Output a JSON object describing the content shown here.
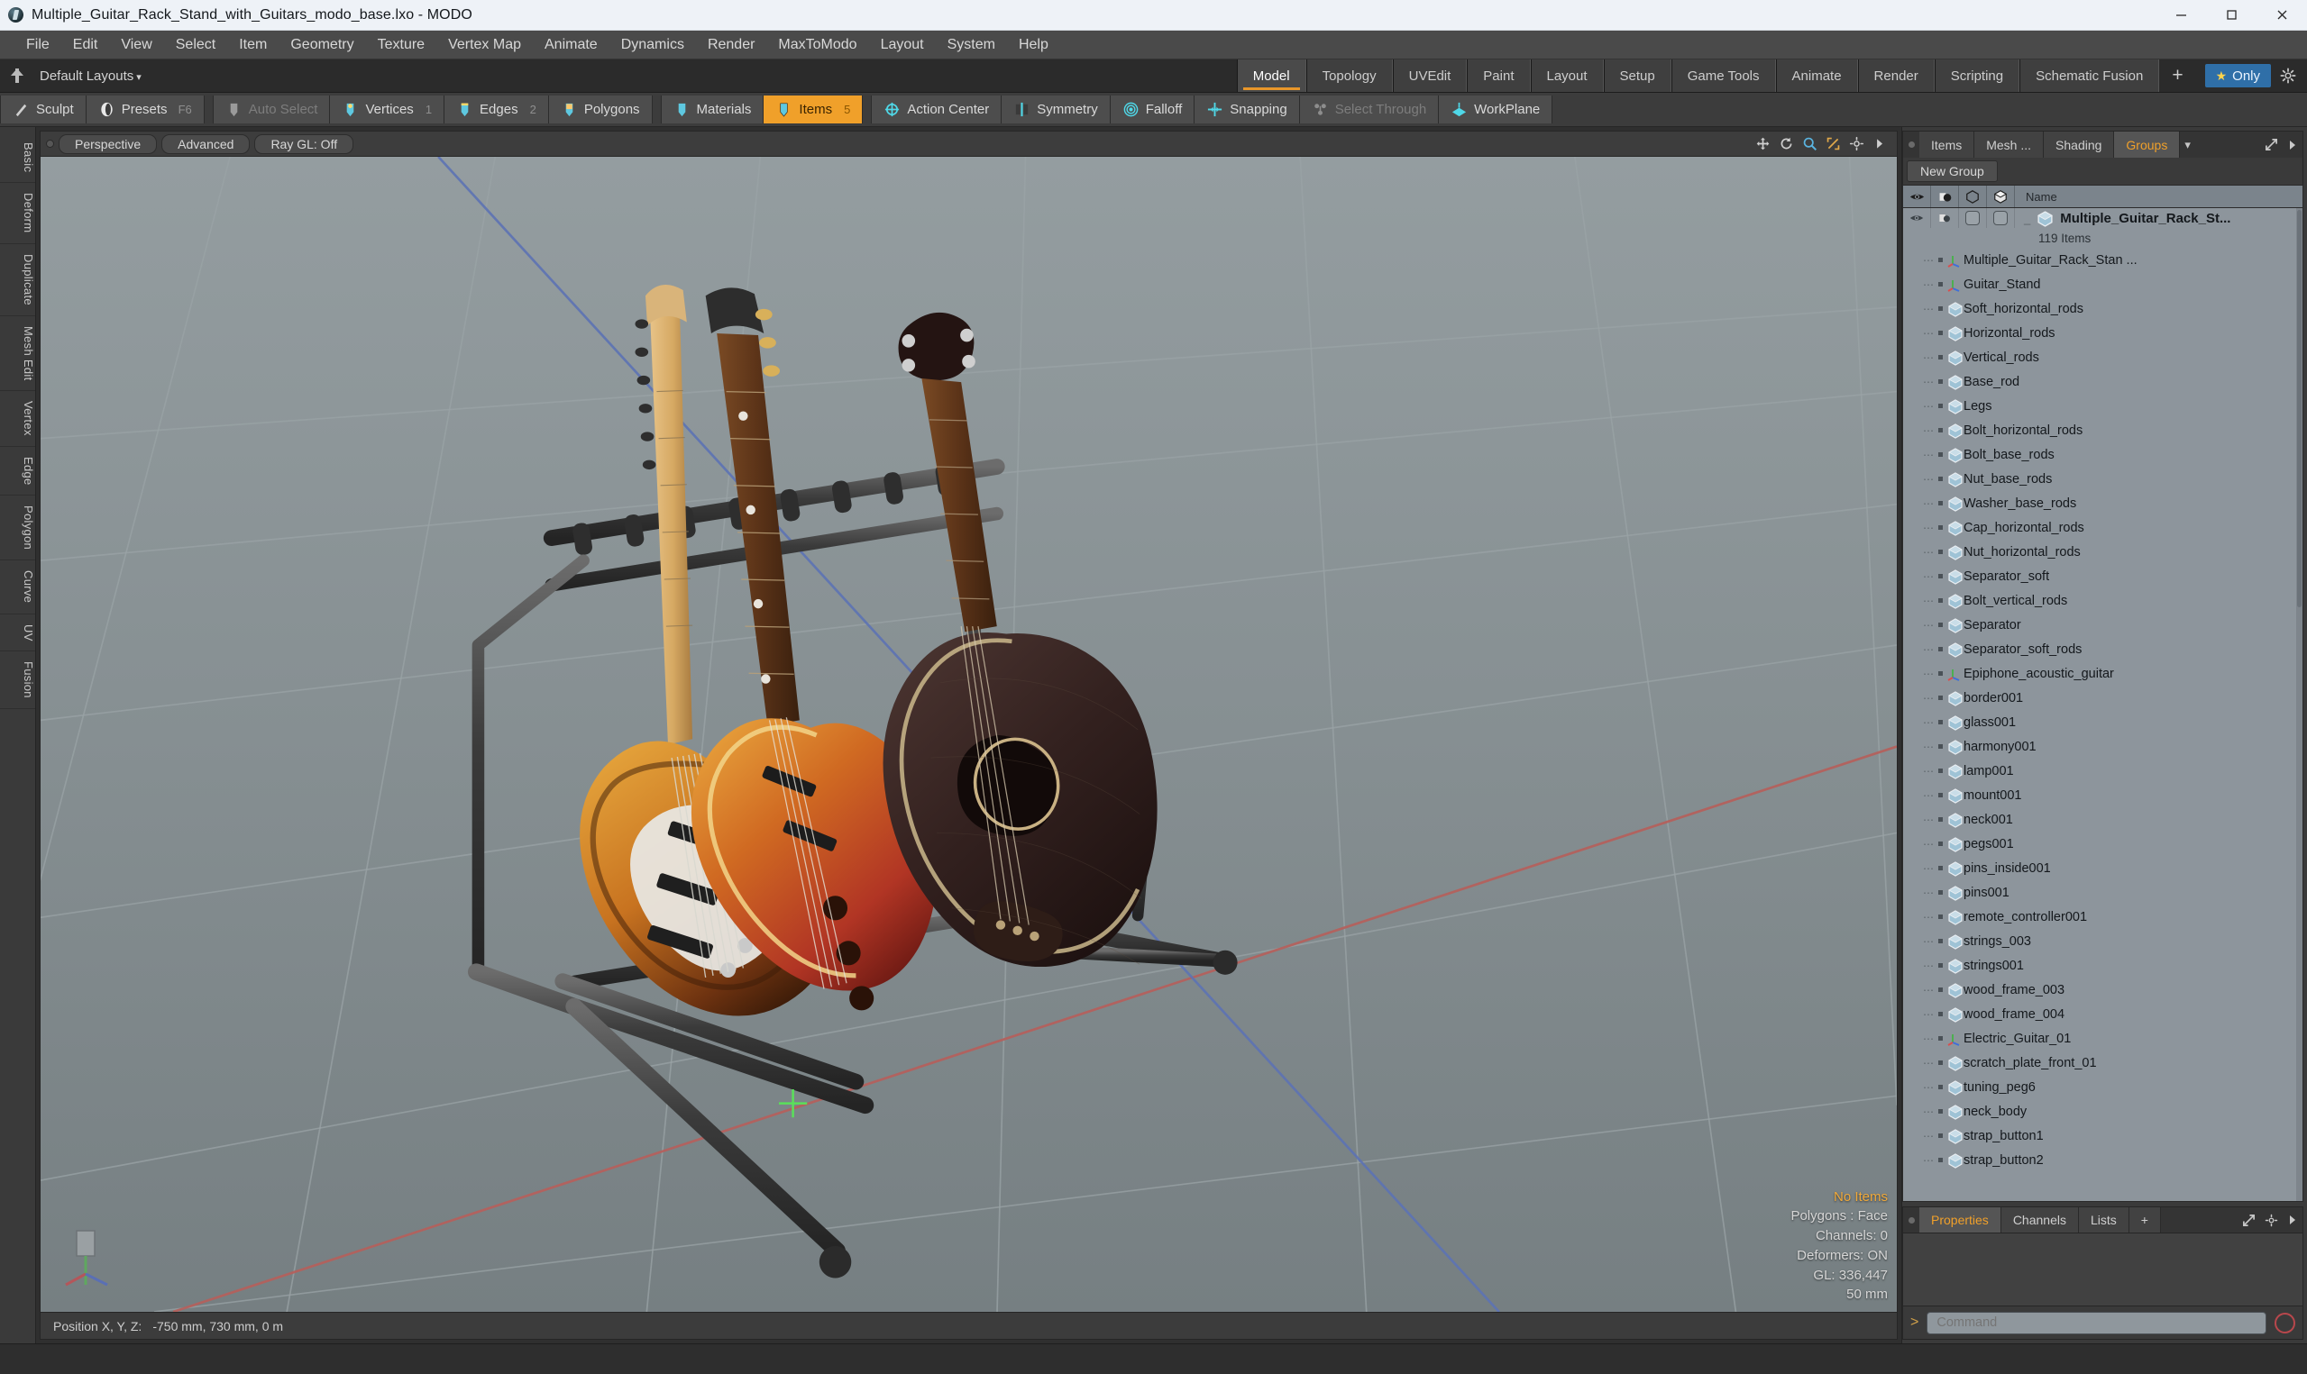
{
  "window": {
    "title": "Multiple_Guitar_Rack_Stand_with_Guitars_modo_base.lxo - MODO",
    "app_icon": "modo-app-icon",
    "minimize": "minimize-icon",
    "maximize": "maximize-icon",
    "close": "close-icon"
  },
  "menubar": {
    "items": [
      {
        "label": "File"
      },
      {
        "label": "Edit"
      },
      {
        "label": "View"
      },
      {
        "label": "Select"
      },
      {
        "label": "Item"
      },
      {
        "label": "Geometry"
      },
      {
        "label": "Texture"
      },
      {
        "label": "Vertex Map"
      },
      {
        "label": "Animate"
      },
      {
        "label": "Dynamics"
      },
      {
        "label": "Render"
      },
      {
        "label": "MaxToModo"
      },
      {
        "label": "Layout"
      },
      {
        "label": "System"
      },
      {
        "label": "Help"
      }
    ]
  },
  "layoutbar": {
    "pin_icon": "pin-icon",
    "layouts_label": "Default Layouts",
    "caret": "▾",
    "tabs": [
      {
        "label": "Model",
        "active": true
      },
      {
        "label": "Topology",
        "active": false
      },
      {
        "label": "UVEdit",
        "active": false
      },
      {
        "label": "Paint",
        "active": false
      },
      {
        "label": "Layout",
        "active": false
      },
      {
        "label": "Setup",
        "active": false
      },
      {
        "label": "Game Tools",
        "active": false
      },
      {
        "label": "Animate",
        "active": false
      },
      {
        "label": "Render",
        "active": false
      },
      {
        "label": "Scripting",
        "active": false
      },
      {
        "label": "Schematic Fusion",
        "active": false
      }
    ],
    "add_label": "+",
    "only_label": "Only",
    "only_star": "★",
    "only_color": "#2f6fa8",
    "gear_icon": "gear-icon"
  },
  "modebar": {
    "groups": [
      {
        "buttons": [
          {
            "label": "Sculpt",
            "icon": "sculpt-icon",
            "key": "",
            "num": "",
            "state": "normal"
          },
          {
            "label": "Presets",
            "icon": "presets-icon",
            "key": "F6",
            "num": "",
            "state": "normal"
          }
        ]
      },
      {
        "buttons": [
          {
            "label": "Auto Select",
            "icon": "auto-select-icon",
            "key": "",
            "num": "",
            "state": "dim"
          },
          {
            "label": "Vertices",
            "icon": "vertices-icon",
            "key": "",
            "num": "1",
            "state": "normal"
          },
          {
            "label": "Edges",
            "icon": "edges-icon",
            "key": "",
            "num": "2",
            "state": "normal"
          },
          {
            "label": "Polygons",
            "icon": "polygons-icon",
            "key": "",
            "num": "",
            "state": "normal"
          }
        ]
      },
      {
        "buttons": [
          {
            "label": "Materials",
            "icon": "materials-icon",
            "key": "",
            "num": "",
            "state": "normal"
          },
          {
            "label": "Items",
            "icon": "items-icon",
            "key": "",
            "num": "5",
            "state": "selected"
          }
        ]
      },
      {
        "buttons": [
          {
            "label": "Action Center",
            "icon": "action-center-icon",
            "key": "",
            "num": "",
            "state": "normal"
          },
          {
            "label": "Symmetry",
            "icon": "symmetry-icon",
            "key": "",
            "num": "",
            "state": "normal"
          },
          {
            "label": "Falloff",
            "icon": "falloff-icon",
            "key": "",
            "num": "",
            "state": "normal"
          },
          {
            "label": "Snapping",
            "icon": "snapping-icon",
            "key": "",
            "num": "",
            "state": "normal"
          },
          {
            "label": "Select Through",
            "icon": "select-through-icon",
            "key": "",
            "num": "",
            "state": "dim"
          },
          {
            "label": "WorkPlane",
            "icon": "workplane-icon",
            "key": "",
            "num": "",
            "state": "normal"
          }
        ]
      }
    ]
  },
  "left_rail": {
    "items": [
      {
        "label": "Basic"
      },
      {
        "label": "Deform"
      },
      {
        "label": "Duplicate"
      },
      {
        "label": "Mesh Edit"
      },
      {
        "label": "Vertex"
      },
      {
        "label": "Edge"
      },
      {
        "label": "Polygon"
      },
      {
        "label": "Curve"
      },
      {
        "label": "UV"
      },
      {
        "label": "Fusion"
      }
    ]
  },
  "viewport": {
    "header": {
      "dot": "viewport-menu-dot",
      "chips": [
        {
          "label": "Perspective"
        },
        {
          "label": "Advanced"
        },
        {
          "label": "Ray GL: Off"
        }
      ],
      "tools": [
        {
          "icon": "move-view-icon"
        },
        {
          "icon": "rotate-view-icon"
        },
        {
          "icon": "zoom-view-icon"
        },
        {
          "icon": "fit-view-icon"
        },
        {
          "icon": "viewport-gear-icon"
        },
        {
          "icon": "viewport-expand-icon"
        }
      ]
    },
    "stats": [
      {
        "label": "No Items",
        "highlight": true
      },
      {
        "label": "Polygons : Face",
        "highlight": false
      },
      {
        "label": "Channels: 0",
        "highlight": false
      },
      {
        "label": "Deformers: ON",
        "highlight": false
      },
      {
        "label": "GL: 336,447",
        "highlight": false
      },
      {
        "label": "50 mm",
        "highlight": false
      }
    ],
    "axis_gizmo": "axis-gizmo-icon"
  },
  "statusbar": {
    "position_label": "Position X, Y, Z:",
    "position_value": "-750 mm, 730 mm, 0 m"
  },
  "right_panel": {
    "tabs": [
      {
        "label": "Items",
        "active": false
      },
      {
        "label": "Mesh ...",
        "active": false
      },
      {
        "label": "Shading",
        "active": false
      },
      {
        "label": "Groups",
        "active": true
      }
    ],
    "tab_caret": "▾",
    "expand_icon": "panel-expand-icon",
    "more_icon": "panel-more-icon",
    "new_group_label": "New Group",
    "tree_header": {
      "col_visible": "eye-icon",
      "col_render": "render-icon",
      "col_wire": "wireframe-cube-icon",
      "col_shade": "shaded-cube-icon",
      "name": "Name"
    },
    "root": {
      "name": "Multiple_Guitar_Rack_St...",
      "icon": "mesh-cube-icon",
      "count_label": "119 Items"
    },
    "items": [
      {
        "label": "Multiple_Guitar_Rack_Stan ...",
        "icon": "locator-icon"
      },
      {
        "label": "Guitar_Stand",
        "icon": "locator-icon"
      },
      {
        "label": "Soft_horizontal_rods",
        "icon": "mesh-cube-icon"
      },
      {
        "label": "Horizontal_rods",
        "icon": "mesh-cube-icon"
      },
      {
        "label": "Vertical_rods",
        "icon": "mesh-cube-icon"
      },
      {
        "label": "Base_rod",
        "icon": "mesh-cube-icon"
      },
      {
        "label": "Legs",
        "icon": "mesh-cube-icon"
      },
      {
        "label": "Bolt_horizontal_rods",
        "icon": "mesh-cube-icon"
      },
      {
        "label": "Bolt_base_rods",
        "icon": "mesh-cube-icon"
      },
      {
        "label": "Nut_base_rods",
        "icon": "mesh-cube-icon"
      },
      {
        "label": "Washer_base_rods",
        "icon": "mesh-cube-icon"
      },
      {
        "label": "Cap_horizontal_rods",
        "icon": "mesh-cube-icon"
      },
      {
        "label": "Nut_horizontal_rods",
        "icon": "mesh-cube-icon"
      },
      {
        "label": "Separator_soft",
        "icon": "mesh-cube-icon"
      },
      {
        "label": "Bolt_vertical_rods",
        "icon": "mesh-cube-icon"
      },
      {
        "label": "Separator",
        "icon": "mesh-cube-icon"
      },
      {
        "label": "Separator_soft_rods",
        "icon": "mesh-cube-icon"
      },
      {
        "label": "Epiphone_acoustic_guitar",
        "icon": "locator-icon"
      },
      {
        "label": "border001",
        "icon": "mesh-cube-icon"
      },
      {
        "label": "glass001",
        "icon": "mesh-cube-icon"
      },
      {
        "label": "harmony001",
        "icon": "mesh-cube-icon"
      },
      {
        "label": "lamp001",
        "icon": "mesh-cube-icon"
      },
      {
        "label": "mount001",
        "icon": "mesh-cube-icon"
      },
      {
        "label": "neck001",
        "icon": "mesh-cube-icon"
      },
      {
        "label": "pegs001",
        "icon": "mesh-cube-icon"
      },
      {
        "label": "pins_inside001",
        "icon": "mesh-cube-icon"
      },
      {
        "label": "pins001",
        "icon": "mesh-cube-icon"
      },
      {
        "label": "remote_controller001",
        "icon": "mesh-cube-icon"
      },
      {
        "label": "strings_003",
        "icon": "mesh-cube-icon"
      },
      {
        "label": "strings001",
        "icon": "mesh-cube-icon"
      },
      {
        "label": "wood_frame_003",
        "icon": "mesh-cube-icon"
      },
      {
        "label": "wood_frame_004",
        "icon": "mesh-cube-icon"
      },
      {
        "label": "Electric_Guitar_01",
        "icon": "locator-icon"
      },
      {
        "label": "scratch_plate_front_01",
        "icon": "mesh-cube-icon"
      },
      {
        "label": "tuning_peg6",
        "icon": "mesh-cube-icon"
      },
      {
        "label": "neck_body",
        "icon": "mesh-cube-icon"
      },
      {
        "label": "strap_button1",
        "icon": "mesh-cube-icon"
      },
      {
        "label": "strap_button2",
        "icon": "mesh-cube-icon"
      }
    ]
  },
  "props_panel": {
    "tabs": [
      {
        "label": "Properties",
        "active": true
      },
      {
        "label": "Channels",
        "active": false
      },
      {
        "label": "Lists",
        "active": false
      },
      {
        "label": "+",
        "active": false
      }
    ],
    "expand_icon": "props-expand-icon",
    "gear_icon": "props-gear-icon",
    "more_icon": "props-more-icon"
  },
  "command_bar": {
    "arrow": ">",
    "placeholder": "Command",
    "record_icon": "record-icon"
  },
  "colors": {
    "accent_orange": "#f0a02a",
    "accent_blue": "#2f6fa8",
    "panel_bg": "#3a3a3a",
    "tree_bg": "#8d959c"
  }
}
